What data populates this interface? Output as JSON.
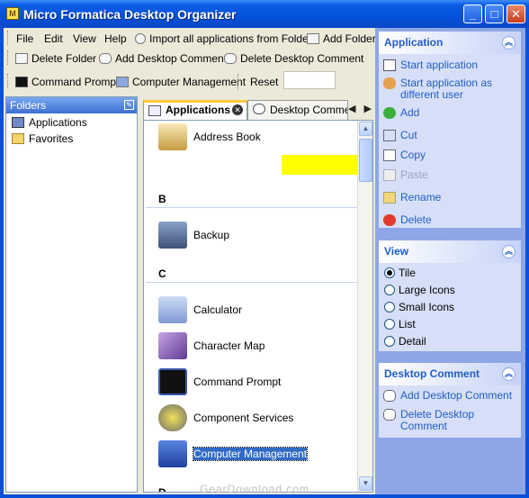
{
  "window": {
    "title": "Micro Formatica Desktop Organizer",
    "controls": {
      "minimize": "_",
      "maximize": "□",
      "close": "✕"
    }
  },
  "toolbar": {
    "menu": [
      "File",
      "Edit",
      "View",
      "Help"
    ],
    "import_label": "Import all applications from Folder",
    "add_folder_label": "Add Folder",
    "delete_folder_label": "Delete Folder",
    "add_comment_label": "Add Desktop Comment",
    "delete_comment_label": "Delete Desktop Comment",
    "command_prompt_label": "Command Prompt",
    "computer_management_label": "Computer Management",
    "reset_label": "Reset"
  },
  "folders": {
    "header": "Folders",
    "items": [
      "Applications",
      "Favorites"
    ]
  },
  "tabs": {
    "items": [
      "Applications",
      "Desktop Comme"
    ],
    "close_glyph": "✕",
    "scroll_left": "◀",
    "scroll_right": "▶"
  },
  "applist": {
    "groups": [
      {
        "letter": "",
        "apps": [
          "Address Book"
        ]
      },
      {
        "letter": "B",
        "apps": [
          "Backup"
        ]
      },
      {
        "letter": "C",
        "apps": [
          "Calculator",
          "Character Map",
          "Command Prompt",
          "Component Services",
          "Computer Management"
        ]
      },
      {
        "letter": "D",
        "apps": []
      }
    ],
    "selected": "Computer Management"
  },
  "panels": {
    "application": {
      "title": "Application",
      "tasks": [
        "Start application",
        "Start application as different user",
        "Add",
        "Cut",
        "Copy",
        "Paste",
        "Rename",
        "Delete"
      ]
    },
    "view": {
      "title": "View",
      "options": [
        "Tile",
        "Large Icons",
        "Small Icons",
        "List",
        "Detail"
      ],
      "selected": "Tile"
    },
    "desktop_comment": {
      "title": "Desktop Comment",
      "tasks": [
        "Add Desktop Comment",
        "Delete Desktop Comment"
      ]
    }
  },
  "watermark": "GearDownload.com"
}
